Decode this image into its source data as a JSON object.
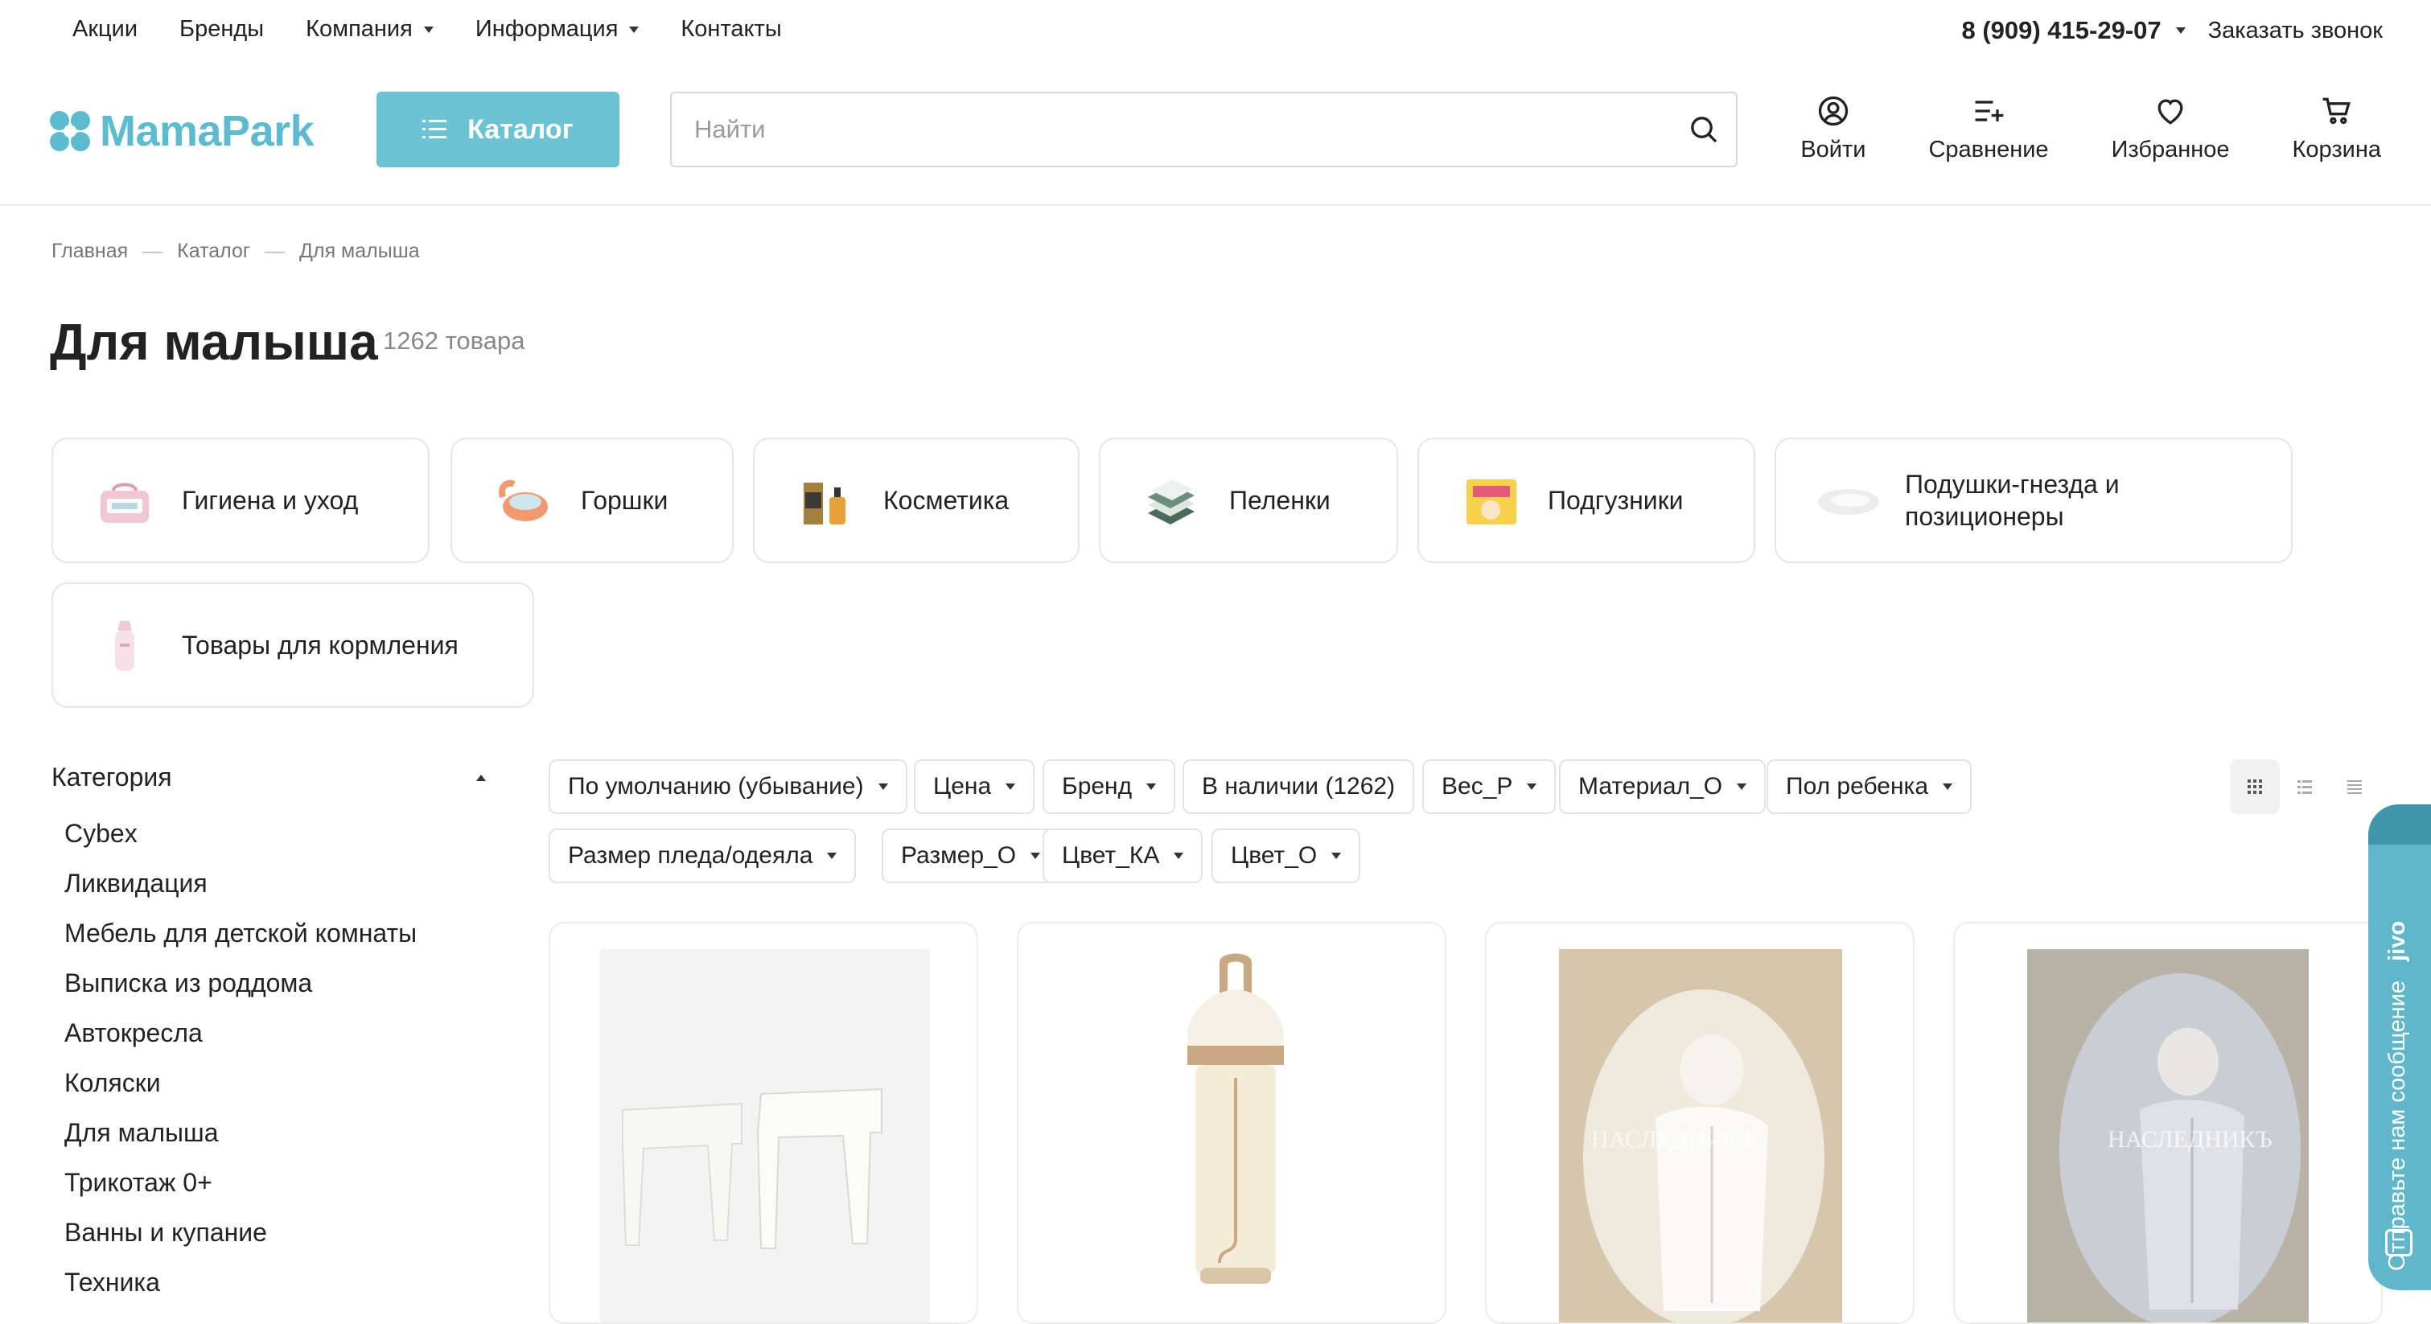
{
  "topnav": {
    "items": [
      {
        "label": "Акции"
      },
      {
        "label": "Бренды"
      },
      {
        "label": "Компания"
      },
      {
        "label": "Информация"
      },
      {
        "label": "Контакты"
      }
    ],
    "phone": "8 (909) 415-29-07",
    "callback": "Заказать звонок"
  },
  "header": {
    "logo_text": "MamaPark",
    "catalog_label": "Каталог",
    "search_placeholder": "Найти",
    "actions": {
      "login": "Войти",
      "compare": "Сравнение",
      "favorites": "Избранное",
      "cart": "Корзина"
    }
  },
  "breadcrumb": [
    "Главная",
    "Каталог",
    "Для малыша"
  ],
  "page": {
    "title": "Для малыша",
    "count": "1262 товара"
  },
  "subcategories": [
    {
      "label": "Гигиена и уход",
      "icon": "hygiene-bag"
    },
    {
      "label": "Горшки",
      "icon": "potty"
    },
    {
      "label": "Косметика",
      "icon": "cosmetics"
    },
    {
      "label": "Пеленки",
      "icon": "diapers-cloth"
    },
    {
      "label": "Подгузники",
      "icon": "diapers-pack"
    },
    {
      "label": "Подушки-гнезда и позиционеры",
      "icon": "nest-pillow"
    },
    {
      "label": "Товары для кормления",
      "icon": "baby-bottle"
    }
  ],
  "sidebar": {
    "heading": "Категория",
    "items": [
      "Cybex",
      "Ликвидация",
      "Мебель для детской комнаты",
      "Выписка из роддома",
      "Автокресла",
      "Коляски",
      "Для малыша",
      "Трикотаж 0+",
      "Ванны и купание",
      "Техника"
    ]
  },
  "filters": {
    "row1": [
      "По умолчанию (убывание)",
      "Цена",
      "Бренд",
      "В наличии (1262)",
      "Вес_Р",
      "Материал_О",
      "Пол ребенка"
    ],
    "row2": [
      "Размер пледа/одеяла",
      "Размер_О",
      "Цвет_КА",
      "Цвет_О"
    ],
    "view_modes": [
      "grid-icon",
      "list-icon",
      "compact-list-icon"
    ]
  },
  "products": [
    {
      "image": "white stools"
    },
    {
      "image": "kids water bottle"
    },
    {
      "image": "newborn in white envelope",
      "watermark": "НАСЛЕДНИКЪ"
    },
    {
      "image": "newborn in grey envelope",
      "watermark": "НАСЛЕДНИКЪ"
    }
  ],
  "chat_widget": {
    "label": "Отправьте нам сообщение",
    "brand": "jivo"
  },
  "colors": {
    "accent": "#6cc3d4",
    "logo": "#5cbbcf",
    "chat": "#5fb7c9"
  }
}
